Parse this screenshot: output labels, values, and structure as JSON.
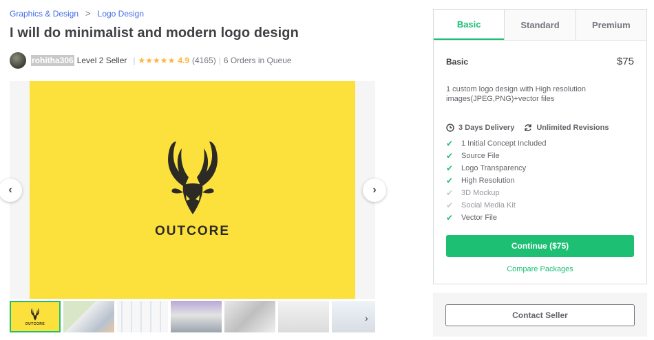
{
  "breadcrumb": {
    "category": "Graphics & Design",
    "separator": ">",
    "subcategory": "Logo Design"
  },
  "gig": {
    "title": "I will do minimalist and modern logo design"
  },
  "seller": {
    "username": "rohitha306",
    "level": "Level 2 Seller",
    "stars": "★★★★★",
    "rating": "4.9",
    "reviews": "(4165)",
    "orders_in_queue": "6 Orders in Queue",
    "divider": "|"
  },
  "gallery": {
    "brand_name": "OUTCORE",
    "prev_icon": "chevron-left-icon",
    "next_icon": "chevron-right-icon",
    "prev_glyph": "‹",
    "next_glyph": "›",
    "thumbs_next_glyph": "›",
    "background_color": "#fce13d"
  },
  "package": {
    "tabs": [
      {
        "label": "Basic",
        "active": true
      },
      {
        "label": "Standard",
        "active": false
      },
      {
        "label": "Premium",
        "active": false
      }
    ],
    "name": "Basic",
    "price": "$75",
    "description": "1 custom logo design with High resolution images(JPEG,PNG)+vector files",
    "delivery": "3 Days Delivery",
    "revisions": "Unlimited Revisions",
    "features": [
      {
        "label": "1 Initial Concept Included",
        "included": true
      },
      {
        "label": "Source File",
        "included": true
      },
      {
        "label": "Logo Transparency",
        "included": true
      },
      {
        "label": "High Resolution",
        "included": true
      },
      {
        "label": "3D Mockup",
        "included": false
      },
      {
        "label": "Social Media Kit",
        "included": false
      },
      {
        "label": "Vector File",
        "included": true
      }
    ],
    "continue_label": "Continue ($75)",
    "compare_label": "Compare Packages",
    "accent_color": "#1dbf73"
  },
  "contact": {
    "label": "Contact Seller"
  }
}
